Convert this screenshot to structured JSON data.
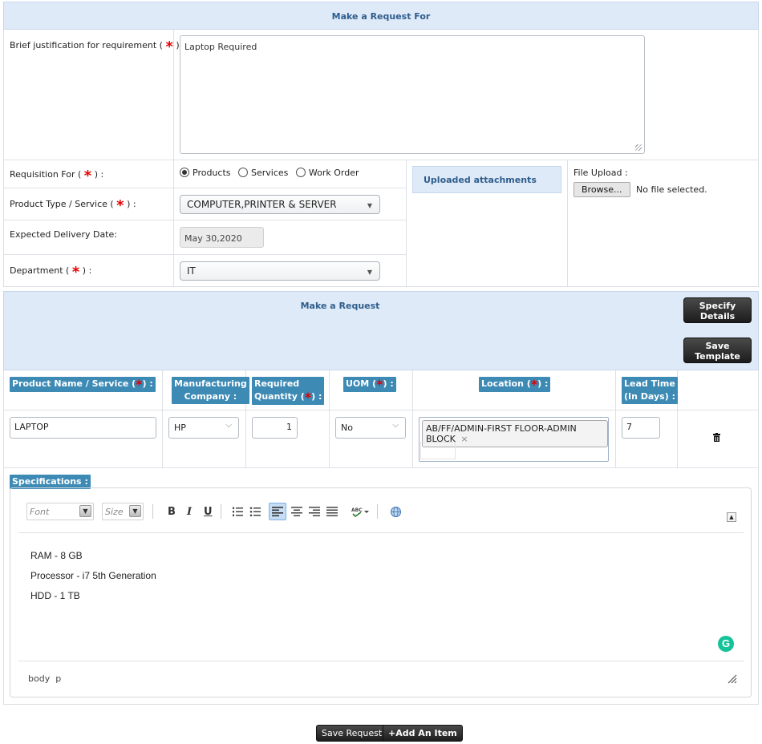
{
  "request_for": {
    "header": "Make a Request For",
    "justification_label": "Brief justification for requirement (",
    "justification_value": "Laptop Required",
    "requisition_label": "Requisition For (",
    "requisition_options": [
      "Products",
      "Services",
      "Work Order"
    ],
    "requisition_selected": "Products",
    "product_type_label": "Product Type / Service (",
    "product_type_value": "COMPUTER,PRINTER & SERVER",
    "delivery_label": "Expected Delivery Date:",
    "delivery_value": "May 30,2020",
    "department_label": "Department (",
    "department_value": "IT",
    "label_close": ")",
    "label_close_colon": ") :",
    "attachments_label": "Uploaded attachments",
    "file_upload_label": "File Upload :",
    "browse_label": "Browse...",
    "no_file_text": "No file selected."
  },
  "make_request": {
    "header": "Make a Request",
    "specify_details_label": [
      "Specify",
      "Details"
    ],
    "save_template_label": [
      "Save",
      "Template"
    ],
    "columns": {
      "product": "Product Name / Service (",
      "manufacturing": [
        "Manufacturing",
        "Company :"
      ],
      "required": [
        "Required",
        "Quantity ("
      ],
      "uom": "UOM (",
      "location": "Location (",
      "lead_time": [
        "Lead Time",
        "(In Days) :"
      ],
      "close": ") :"
    },
    "row": {
      "product": "LAPTOP",
      "manufacturer": "HP",
      "quantity": "1",
      "uom": "No",
      "location": "AB/FF/ADMIN-FIRST FLOOR-ADMIN BLOCK",
      "lead_time": "7"
    },
    "specifications_label": "Specifications :",
    "editor": {
      "font_placeholder": "Font",
      "size_placeholder": "Size",
      "bold": "B",
      "italic": "I",
      "underline": "U",
      "content": [
        "RAM - 8 GB",
        "Processor - i7 5th Generation",
        "HDD - 1 TB"
      ],
      "path": "body  p"
    }
  },
  "footer": {
    "save_request": "Save Request",
    "add_item": "+Add An Item"
  }
}
